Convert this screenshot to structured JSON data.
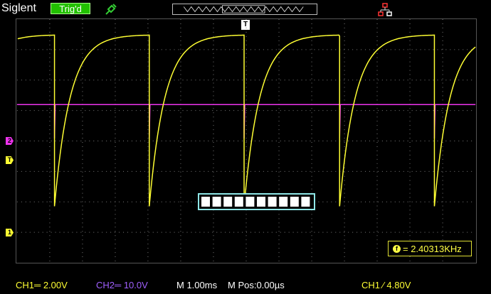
{
  "header": {
    "brand": "Siglent",
    "trigger_status": "Trig'd",
    "icons": {
      "probe": "probe-icon",
      "memory": "memory-waveform-icon",
      "network": "network-icon"
    }
  },
  "markers": {
    "ch2": "2",
    "trigger_level": "T",
    "ch1": "1",
    "trigger_position": "T"
  },
  "measurement": {
    "icon": "f",
    "frequency": "= 2.40313KHz"
  },
  "progress": {
    "segments": 10,
    "filled_fraction": 1.0
  },
  "status_bar": {
    "ch1": "CH1═ 2.00V",
    "ch2": "CH2═ 10.0V",
    "timebase": "M 1.00ms",
    "mpos": "M Pos:0.00µs",
    "trigger": "CH1 ∕ 4.80V"
  },
  "colors": {
    "ch1": "#ffff33",
    "ch2": "#ee33ee",
    "trig_badge": "#22c000",
    "status_ch2": "#a060ff",
    "grid": "#7a7a7a"
  }
}
